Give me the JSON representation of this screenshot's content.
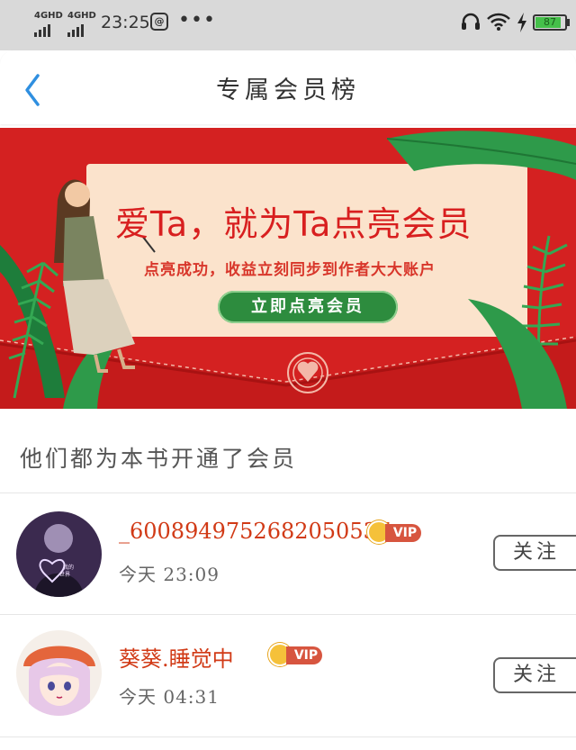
{
  "status_bar": {
    "network_1": "4GHD",
    "network_2": "4GHD",
    "time": "23:25",
    "app_badge": "@",
    "more": "•••",
    "battery_percent": "87",
    "battery_level": 0.87
  },
  "nav": {
    "title": "专属会员榜",
    "back_icon": "chevron-left-icon"
  },
  "banner": {
    "headline": "爱Ta，就为Ta点亮会员",
    "subtitle": "点亮成功，收益立刻同步到作者大大账户",
    "cta_label": "立即点亮会员",
    "colors": {
      "background": "#d42121",
      "card": "#fbe3cc",
      "cta": "#2d8c3e"
    }
  },
  "section": {
    "title": "他们都为本书开通了会员"
  },
  "members": [
    {
      "name": "_6008949752682050537",
      "vip_label": "VIP",
      "time": "今天 23:09",
      "follow_label": "关注"
    },
    {
      "name": "葵葵.睡觉中",
      "vip_label": "VIP",
      "time": "今天 04:31",
      "follow_label": "关注"
    }
  ],
  "colors": {
    "accent_blue": "#2f8fe0",
    "name_red": "#d13a16"
  }
}
